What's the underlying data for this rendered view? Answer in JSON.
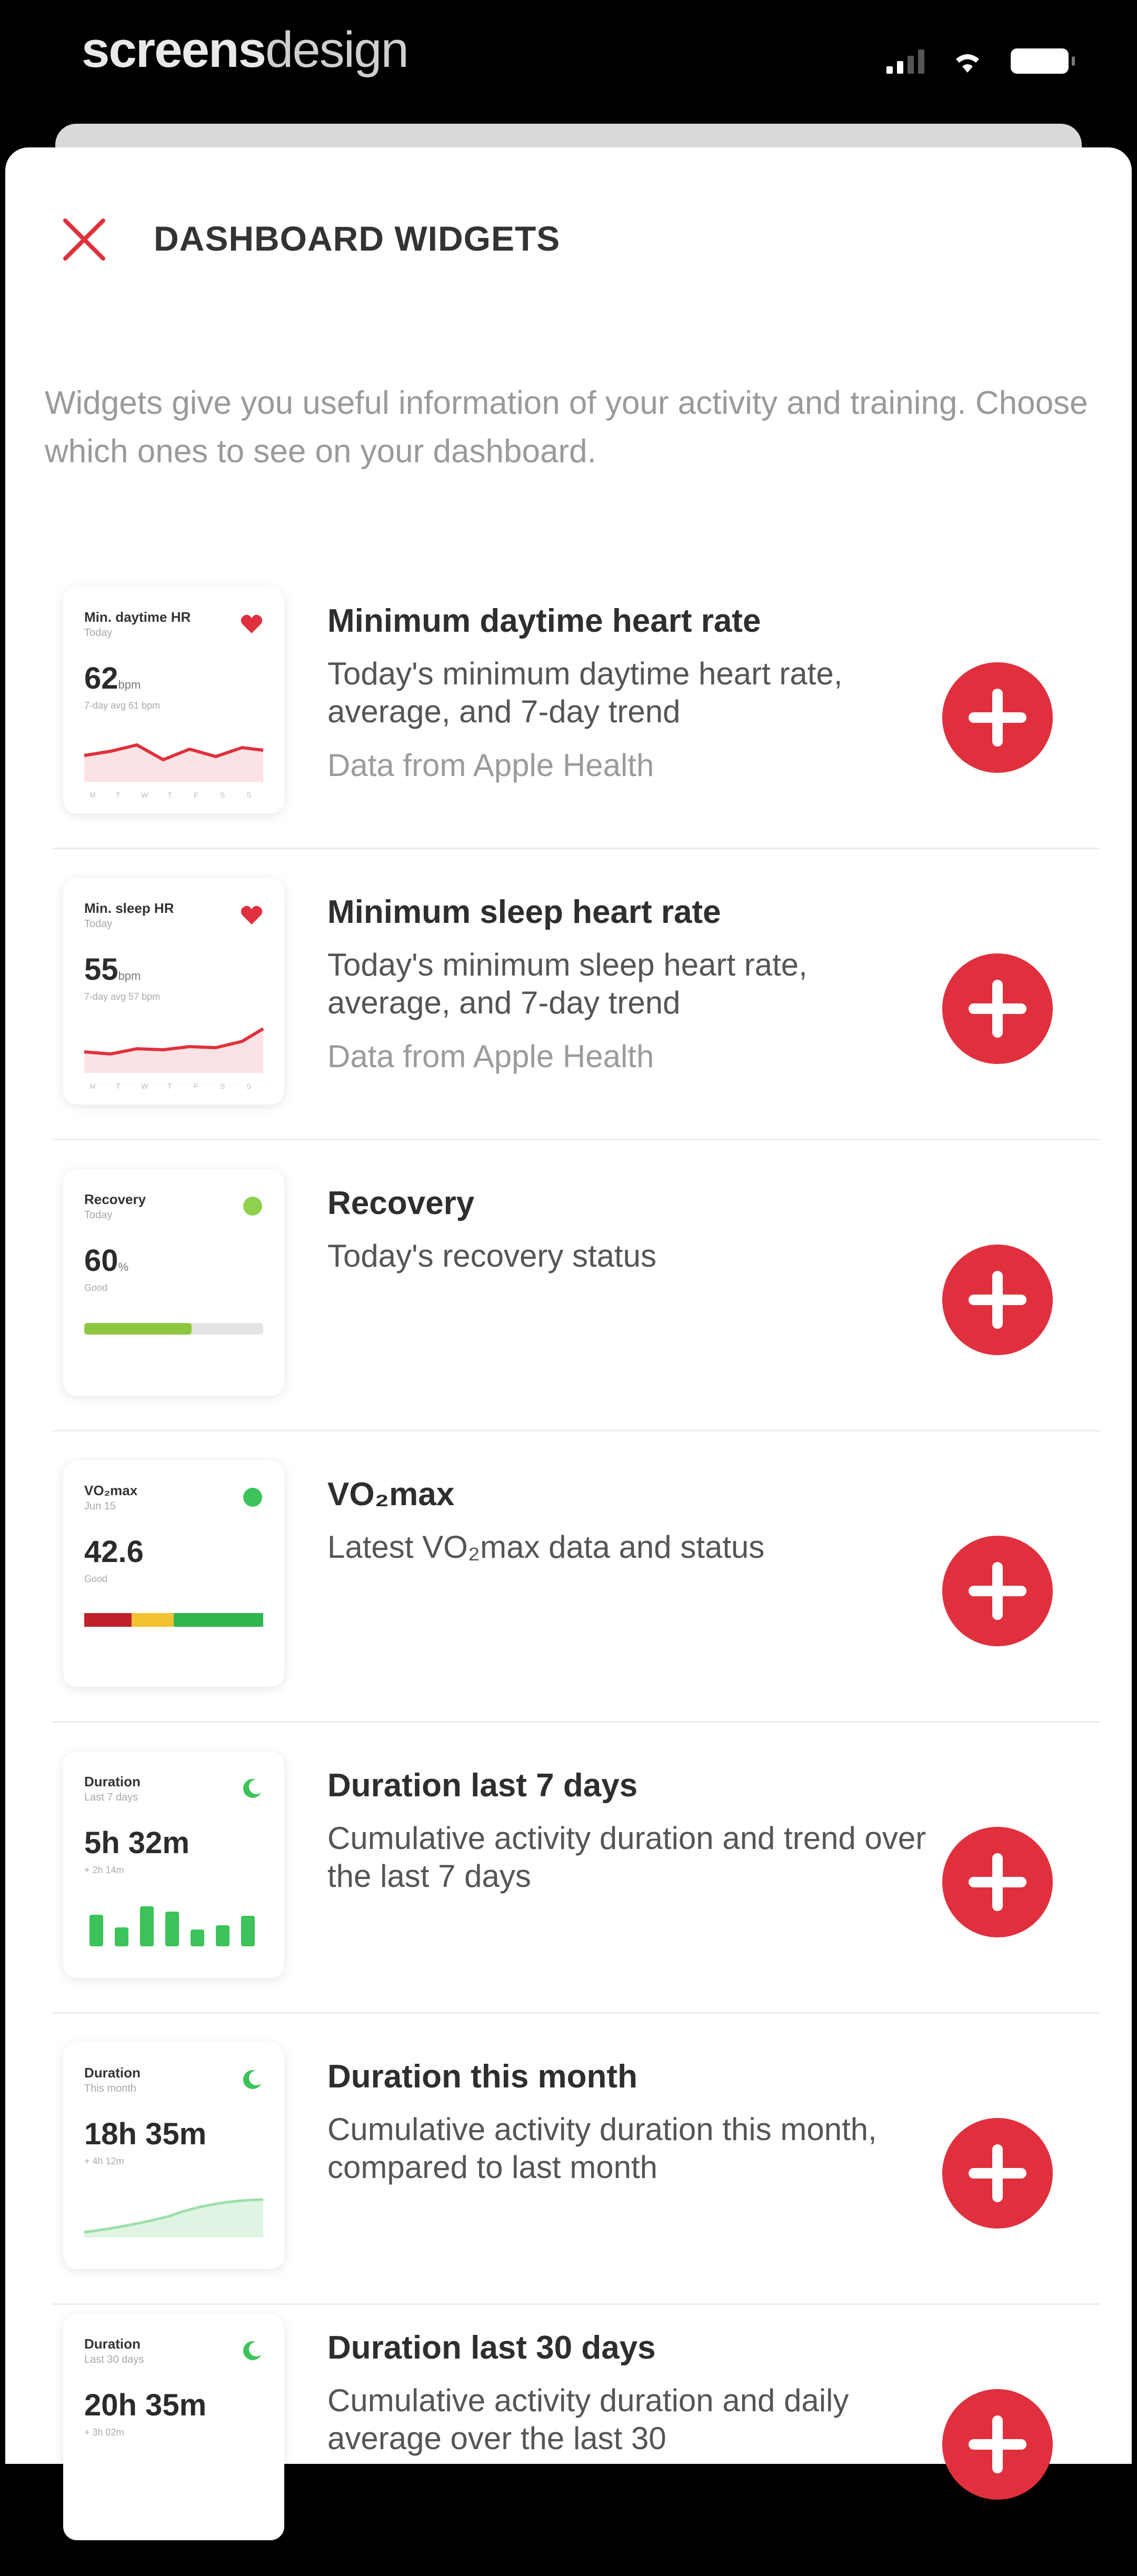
{
  "watermark": {
    "bold": "screens",
    "light": "design"
  },
  "header": {
    "title": "DASHBOARD WIDGETS"
  },
  "intro": "Widgets give you useful information of your activity and training. Choose which ones to see on your dashboard.",
  "accent_color": "#e0303d",
  "widgets": [
    {
      "title": "Minimum daytime heart rate",
      "description": "Today's minimum daytime heart rate, average, and 7-day trend",
      "source": "Data from Apple Health",
      "thumb": {
        "title": "Min. daytime HR",
        "sub": "Today",
        "value": "62",
        "unit": "bpm",
        "note": "7-day avg 61 bpm",
        "icon": "heart-icon"
      }
    },
    {
      "title": "Minimum sleep heart rate",
      "description": "Today's minimum sleep heart rate, average, and 7-day trend",
      "source": "Data from Apple Health",
      "thumb": {
        "title": "Min. sleep HR",
        "sub": "Today",
        "value": "55",
        "unit": "bpm",
        "note": "7-day avg 57 bpm",
        "icon": "heart-icon"
      }
    },
    {
      "title": "Recovery",
      "description": "Today's recovery status",
      "source": "",
      "thumb": {
        "title": "Recovery",
        "sub": "Today",
        "value": "60",
        "unit": "%",
        "note": "Good",
        "icon": "status-dot-icon",
        "progress": 0.6
      }
    },
    {
      "title": "VO₂max",
      "description": "Latest VO₂max data and status",
      "source": "",
      "thumb": {
        "title": "VO₂max",
        "sub": "Jun 15",
        "value": "42.6",
        "unit": "",
        "note": "Good",
        "icon": "status-dot-icon"
      }
    },
    {
      "title": "Duration last 7 days",
      "description": "Cumulative activity duration and trend over the last 7 days",
      "source": "",
      "thumb": {
        "title": "Duration",
        "sub": "Last 7 days",
        "value": "5h 32m",
        "unit": "",
        "note": "+ 2h 14m",
        "icon": "moon-icon"
      }
    },
    {
      "title": "Duration this month",
      "description": "Cumulative activity duration this month, compared to last month",
      "source": "",
      "thumb": {
        "title": "Duration",
        "sub": "This month",
        "value": "18h 35m",
        "unit": "",
        "note": "+ 4h 12m",
        "icon": "moon-icon"
      }
    },
    {
      "title": "Duration last 30 days",
      "description": "Cumulative activity duration and daily average over the last 30",
      "source": "",
      "thumb": {
        "title": "Duration",
        "sub": "Last 30 days",
        "value": "20h 35m",
        "unit": "",
        "note": "+ 3h 02m",
        "icon": "moon-icon"
      }
    }
  ]
}
